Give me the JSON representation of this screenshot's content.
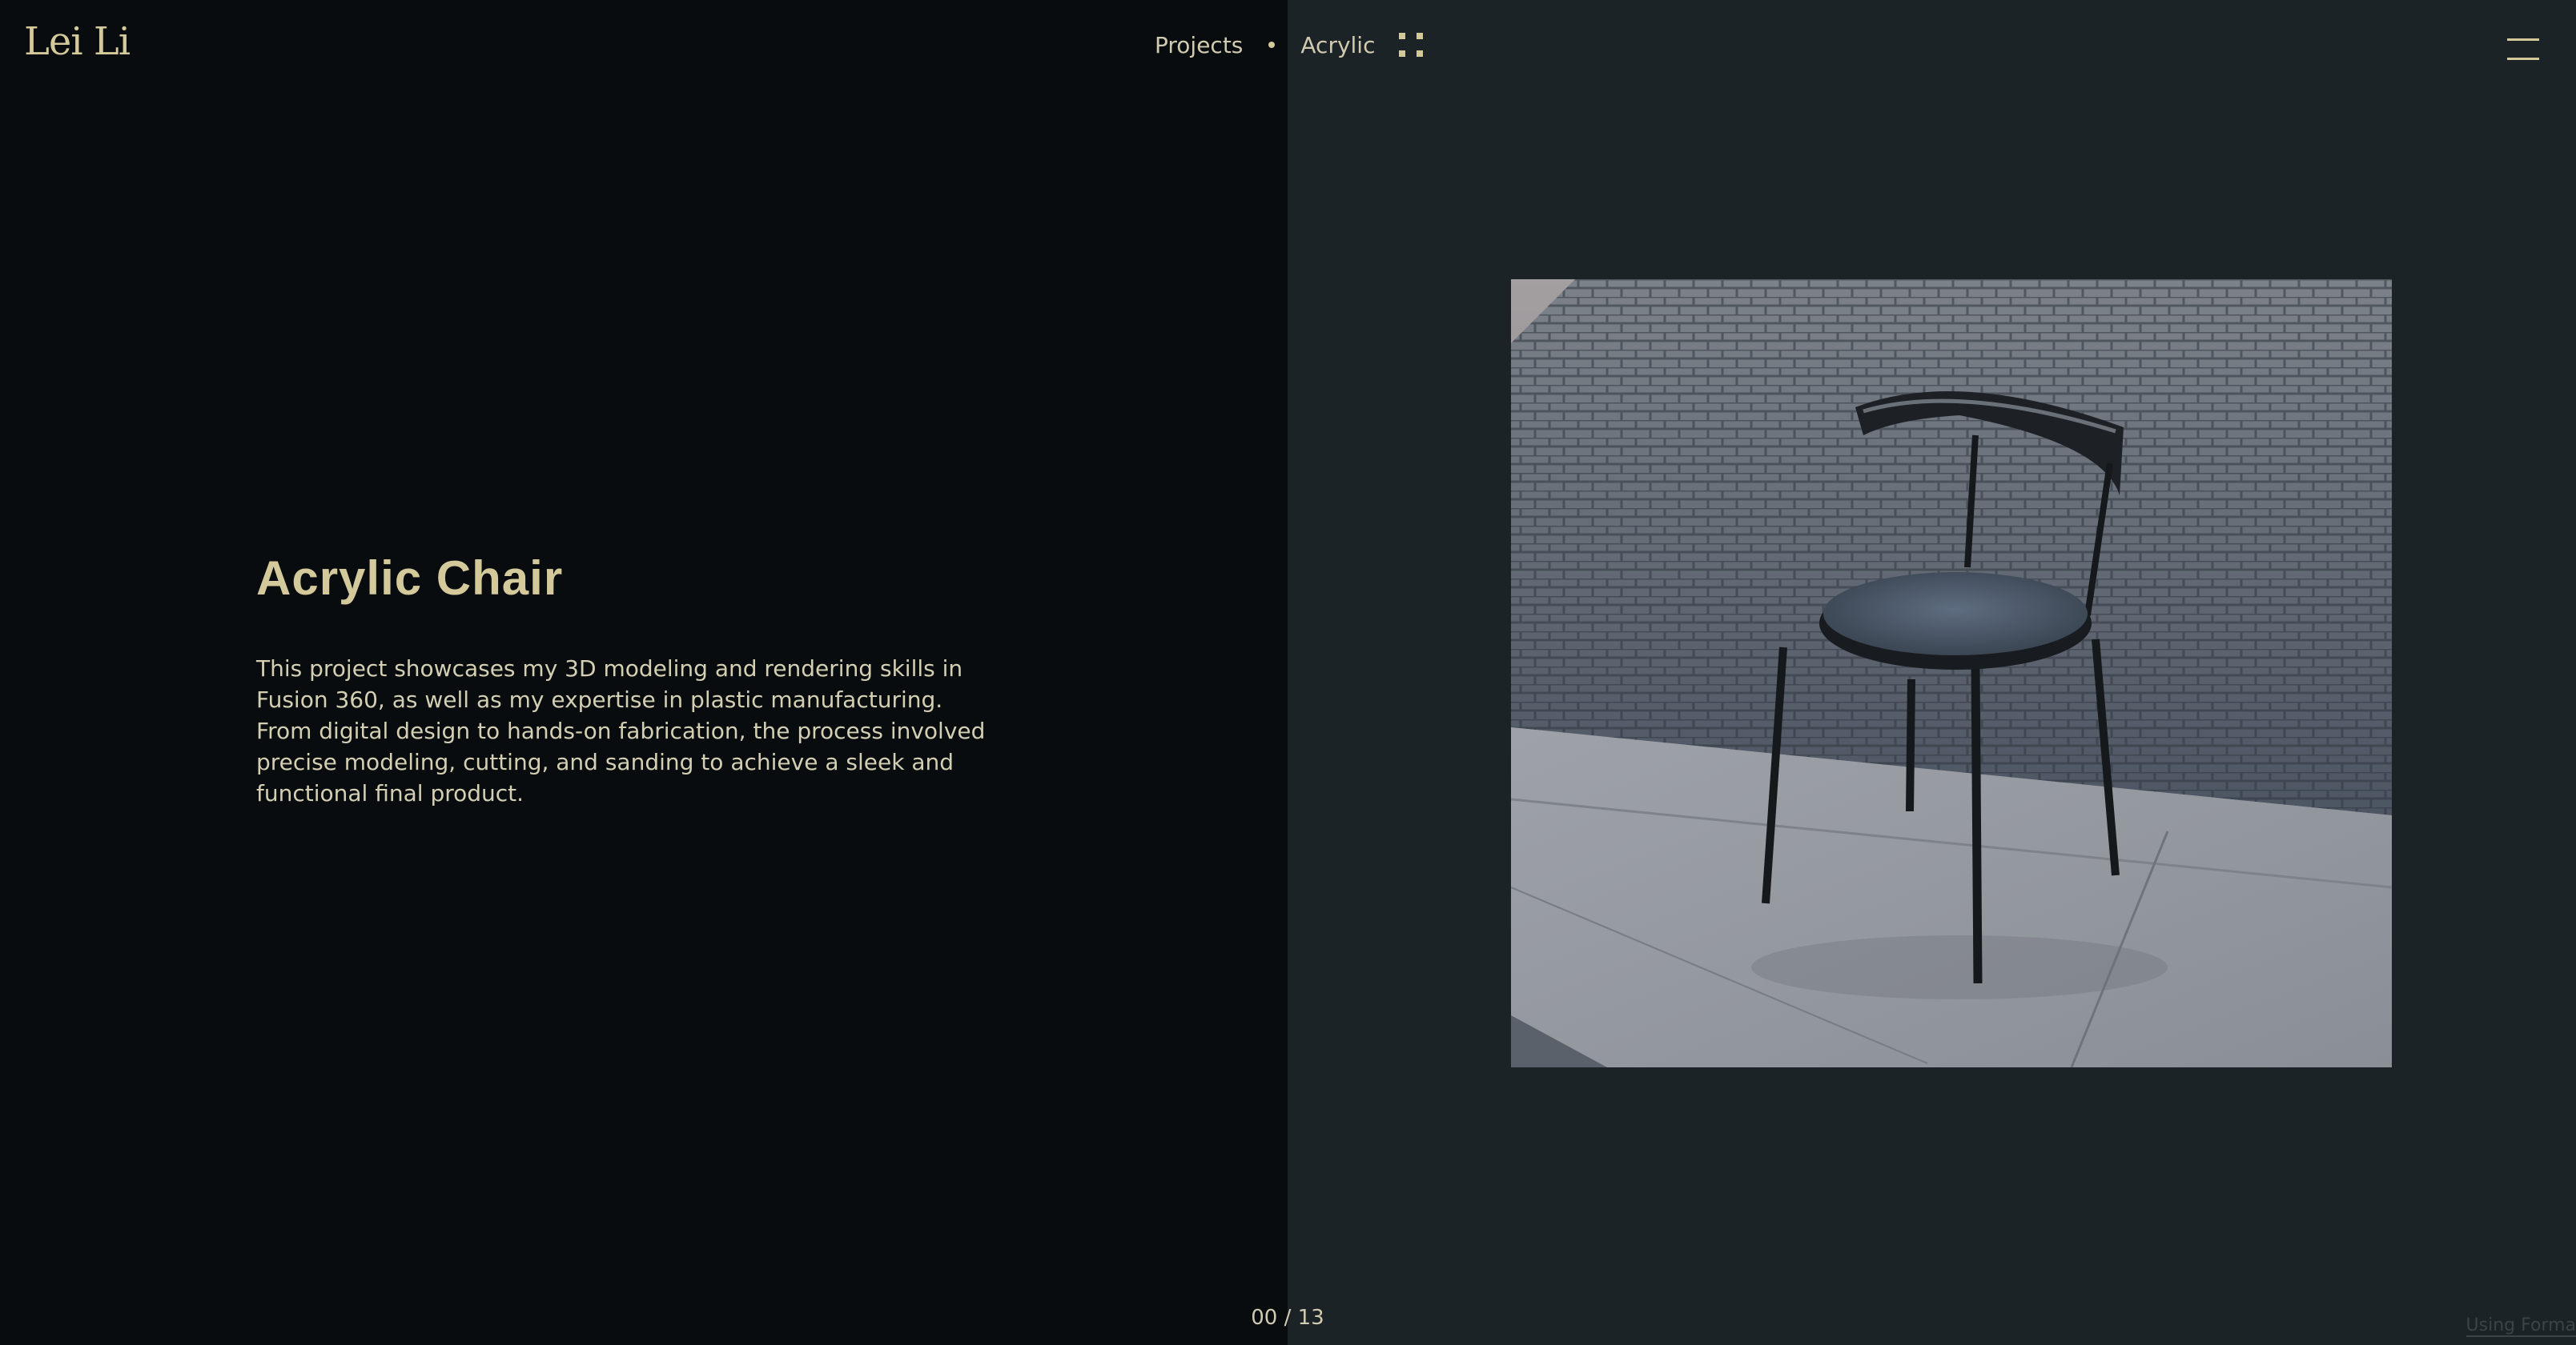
{
  "header": {
    "logo": "Lei Li",
    "nav": {
      "projects_label": "Projects",
      "current_label": "Acrylic"
    },
    "grid_icon": "grid-icon",
    "menu_icon": "menu-icon"
  },
  "project": {
    "title": "Acrylic Chair",
    "description": "This project showcases my 3D modeling and rendering skills in Fusion 360, as well as my expertise in plastic manufacturing. From digital design to hands-on fabrication, the process involved precise modeling, cutting, and sanding to achieve a sleek and functional final product."
  },
  "pagination": {
    "counter": "00 / 13"
  },
  "footer": {
    "credit": "Using Forma"
  },
  "colors": {
    "accent": "#d4c99a",
    "left_bg": "#080c0f",
    "right_bg": "#1c2326"
  }
}
